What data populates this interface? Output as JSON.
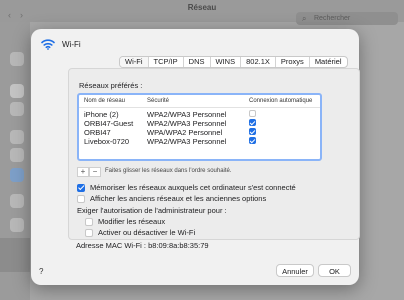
{
  "background_window": {
    "title": "Réseau",
    "search_placeholder": "Rechercher"
  },
  "sheet": {
    "title": "Wi-Fi",
    "tabs": [
      {
        "label": "Wi-Fi",
        "active": true
      },
      {
        "label": "TCP/IP",
        "active": false
      },
      {
        "label": "DNS",
        "active": false
      },
      {
        "label": "WINS",
        "active": false
      },
      {
        "label": "802.1X",
        "active": false
      },
      {
        "label": "Proxys",
        "active": false
      },
      {
        "label": "Matériel",
        "active": false
      }
    ],
    "preferred_networks_label": "Réseaux préférés :",
    "table": {
      "headers": [
        "Nom de réseau",
        "Sécurité",
        "Connexion automatique"
      ],
      "rows": [
        {
          "name": "iPhone (2)",
          "security": "WPA2/WPA3 Personnel",
          "auto": false
        },
        {
          "name": "ORBI47-Guest",
          "security": "WPA2/WPA3 Personnel",
          "auto": true
        },
        {
          "name": "ORBI47",
          "security": "WPA/WPA2 Personnel",
          "auto": true
        },
        {
          "name": "Livebox-0720",
          "security": "WPA2/WPA3 Personnel",
          "auto": true
        }
      ]
    },
    "add_label": "+",
    "remove_label": "−",
    "drag_hint": "Faites glisser les réseaux dans l'ordre souhaité.",
    "remember_networks": {
      "label": "Mémoriser les réseaux auxquels cet ordinateur s'est connecté",
      "checked": true
    },
    "show_legacy": {
      "label": "Afficher les anciens réseaux et les anciennes options",
      "checked": false
    },
    "admin_label": "Exiger l'autorisation de l'administrateur pour :",
    "modify_networks": {
      "label": "Modifier les réseaux",
      "checked": false
    },
    "toggle_wifi": {
      "label": "Activer ou désactiver le Wi-Fi",
      "checked": false
    },
    "mac_address": "Adresse MAC Wi-Fi :  b8:09:8a:b8:35:79",
    "help_label": "?",
    "cancel_label": "Annuler",
    "ok_label": "OK"
  }
}
